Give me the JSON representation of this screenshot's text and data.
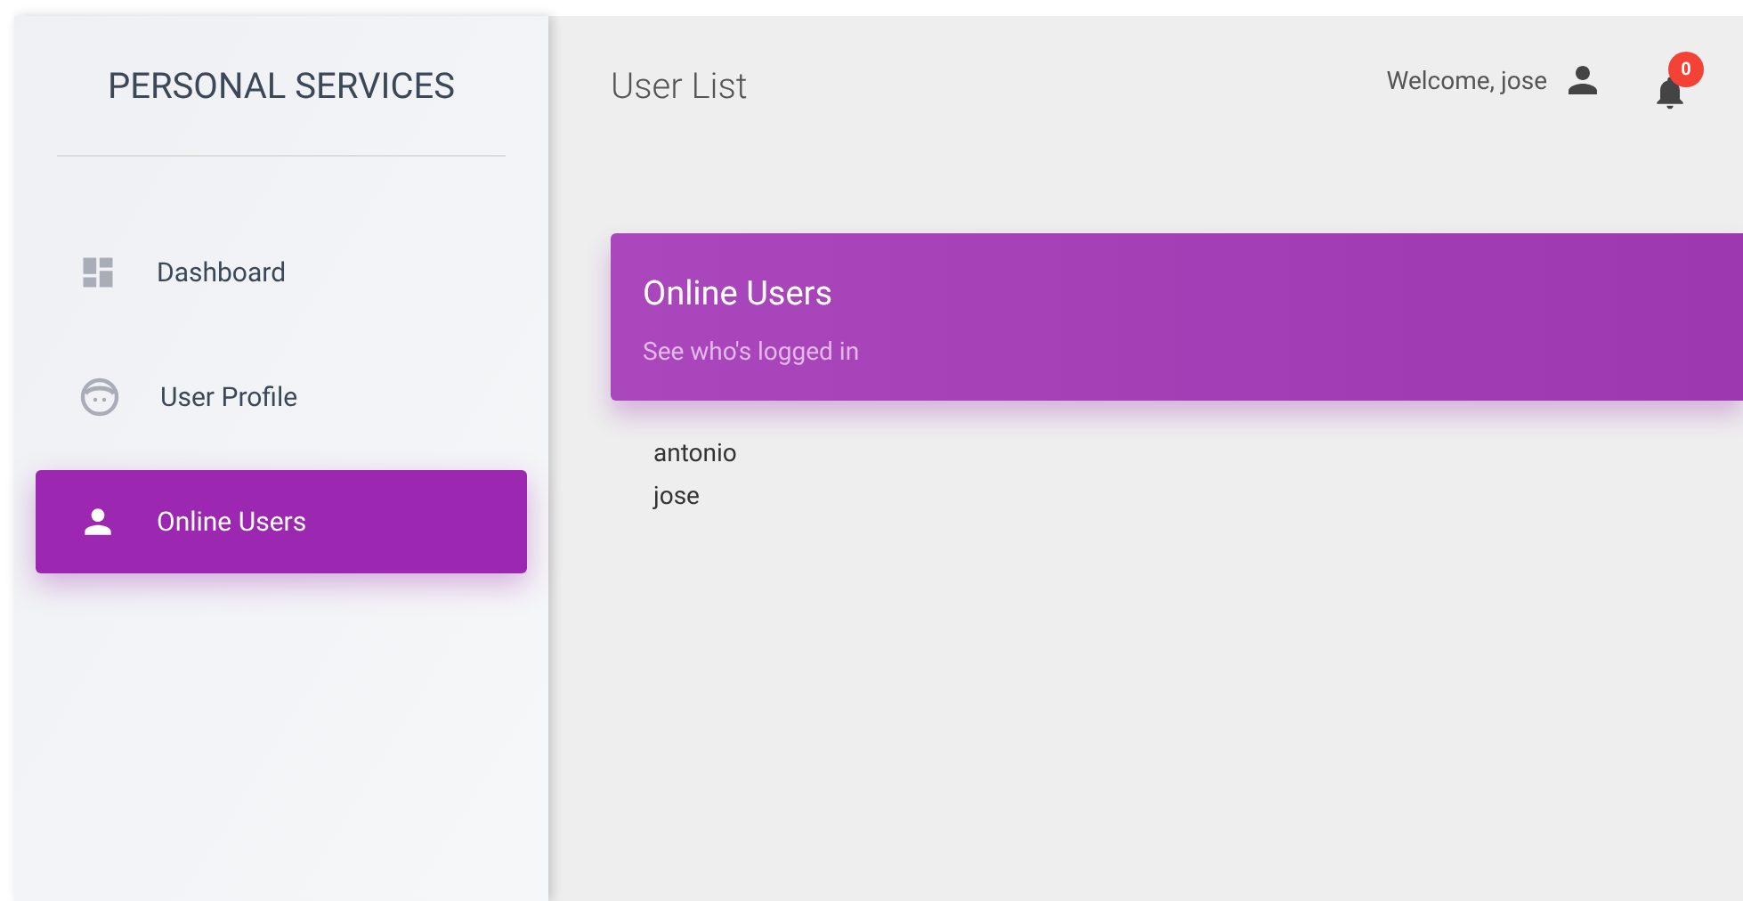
{
  "sidebar": {
    "brand": "PERSONAL SERVICES",
    "items": [
      {
        "label": "Dashboard",
        "selected": false
      },
      {
        "label": "User Profile",
        "selected": false
      },
      {
        "label": "Online Users",
        "selected": true
      }
    ]
  },
  "header": {
    "title": "User List",
    "welcome": "Welcome, jose",
    "notifications": "0"
  },
  "card": {
    "title": "Online Users",
    "subtitle": "See who's logged in",
    "users": [
      "antonio",
      "jose"
    ]
  }
}
